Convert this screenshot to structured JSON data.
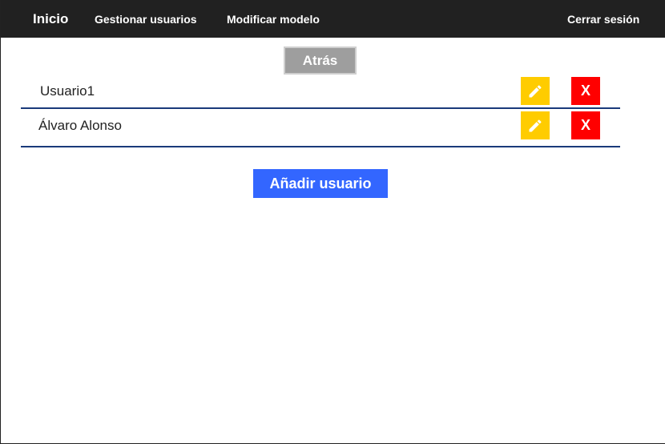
{
  "nav": {
    "brand": "Inicio",
    "manage_users": "Gestionar usuarios",
    "modify_model": "Modificar modelo",
    "logout": "Cerrar sesión"
  },
  "back_label": "Atrás",
  "users": [
    {
      "name": "Usuario1",
      "edit_icon": "pencil-icon",
      "delete_label": "X"
    },
    {
      "name": "Álvaro Alonso",
      "edit_icon": "pencil-icon",
      "delete_label": "X"
    }
  ],
  "add_user_label": "Añadir usuario",
  "colors": {
    "navbar": "#212121",
    "back_button": "#9e9e9e",
    "edit_button": "#ffcc00",
    "delete_button": "#ff0000",
    "add_button": "#3366ff",
    "row_divider": "#1a3a7a"
  }
}
